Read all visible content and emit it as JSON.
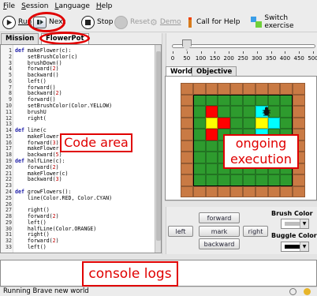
{
  "menu": [
    "File",
    "Session",
    "Language",
    "Help"
  ],
  "toolbar": {
    "run": "Run",
    "next": "Next",
    "stop": "Stop",
    "reset": "Reset",
    "demo": "Demo",
    "help": "Call for Help",
    "switch": "Switch exercise"
  },
  "code_tabs": [
    "Mission",
    "FlowerPot"
  ],
  "code_lines": [
    {
      "n": "1",
      "kw": "def ",
      "rest": "makeFlower(c):"
    },
    {
      "n": "2",
      "kw": "",
      "rest": "    setBrushColor(c)"
    },
    {
      "n": "3",
      "kw": "",
      "rest": "    brushDown()"
    },
    {
      "n": "4",
      "kw": "",
      "rest": "    forward(",
      "num": "2",
      "end": ")"
    },
    {
      "n": "5",
      "kw": "",
      "rest": "    backward()"
    },
    {
      "n": "6",
      "kw": "",
      "rest": "    left()"
    },
    {
      "n": "7",
      "kw": "",
      "rest": "    forward()"
    },
    {
      "n": "8",
      "kw": "",
      "rest": "    backward(",
      "num": "2",
      "end": ")"
    },
    {
      "n": "9",
      "kw": "",
      "rest": "    forward()"
    },
    {
      "n": "10",
      "kw": "",
      "rest": "    setBrushColor(Color.YELLOW)"
    },
    {
      "n": "11",
      "kw": "",
      "rest": "    brushU"
    },
    {
      "n": "12",
      "kw": "",
      "rest": "    right("
    },
    {
      "n": "13",
      "kw": "",
      "rest": ""
    },
    {
      "n": "14",
      "kw": "def ",
      "rest": "line(c"
    },
    {
      "n": "15",
      "kw": "",
      "rest": "    makeFlower(c1)"
    },
    {
      "n": "16",
      "kw": "",
      "rest": "    forward(",
      "num": "3",
      "end": ")"
    },
    {
      "n": "17",
      "kw": "",
      "rest": "    makeFlower(c2)"
    },
    {
      "n": "18",
      "kw": "",
      "rest": "    backward(",
      "num": "5",
      "end": ")"
    },
    {
      "n": "19",
      "kw": "def ",
      "rest": "halfLine(c):"
    },
    {
      "n": "20",
      "kw": "",
      "rest": "    forward(",
      "num": "2",
      "end": ")"
    },
    {
      "n": "21",
      "kw": "",
      "rest": "    makeFlower(c)"
    },
    {
      "n": "22",
      "kw": "",
      "rest": "    backward(",
      "num": "3",
      "end": ")"
    },
    {
      "n": "23",
      "kw": "",
      "rest": ""
    },
    {
      "n": "24",
      "kw": "def ",
      "rest": "growFlowers():"
    },
    {
      "n": "25",
      "kw": "",
      "rest": "    line(Color.RED, Color.CYAN)"
    },
    {
      "n": "26",
      "kw": "",
      "rest": ""
    },
    {
      "n": "27",
      "kw": "",
      "rest": "    right()"
    },
    {
      "n": "28",
      "kw": "",
      "rest": "    forward(",
      "num": "2",
      "end": ")"
    },
    {
      "n": "29",
      "kw": "",
      "rest": "    left()"
    },
    {
      "n": "30",
      "kw": "",
      "rest": "    halfLine(Color.ORANGE)"
    },
    {
      "n": "31",
      "kw": "",
      "rest": "    right()"
    },
    {
      "n": "32",
      "kw": "",
      "rest": "    forward(",
      "num": "2",
      "end": ")"
    },
    {
      "n": "33",
      "kw": "",
      "rest": "    left()"
    }
  ],
  "speed_ticks": [
    "0",
    "50",
    "100",
    "150",
    "200",
    "250",
    "300",
    "350",
    "400",
    "450",
    "500"
  ],
  "speed_value": 50,
  "world_tabs": [
    "World",
    "Objective"
  ],
  "colors": {
    "background": "#c97a44",
    "grass": "#2e9b2e",
    "red": "#ff0000",
    "yellow": "#ffff00",
    "cyan": "#00ffff",
    "annotation": "#e00000"
  },
  "world_cells": [
    "OOOOOOOOOO",
    "OGGGGGGGGO",
    "OGRGGGCGGO",
    "OGYRGGYCGO",
    "OGRGGGCGGO",
    "OGGGGGGGGO",
    "OGGGGGGGGO",
    "OGGGGGGGGO",
    "OGGGGGGGGO",
    "OOOOOOOOOO"
  ],
  "controls": {
    "forward": "forward",
    "left": "left",
    "mark": "mark",
    "right": "right",
    "backward": "backward",
    "brush_color_label": "Brush Color",
    "buggle_color_label": "Buggle Color"
  },
  "annotations": {
    "code_area": "Code area",
    "execution": "ongoing execution",
    "console": "console logs"
  },
  "status": "Running Brave new world"
}
